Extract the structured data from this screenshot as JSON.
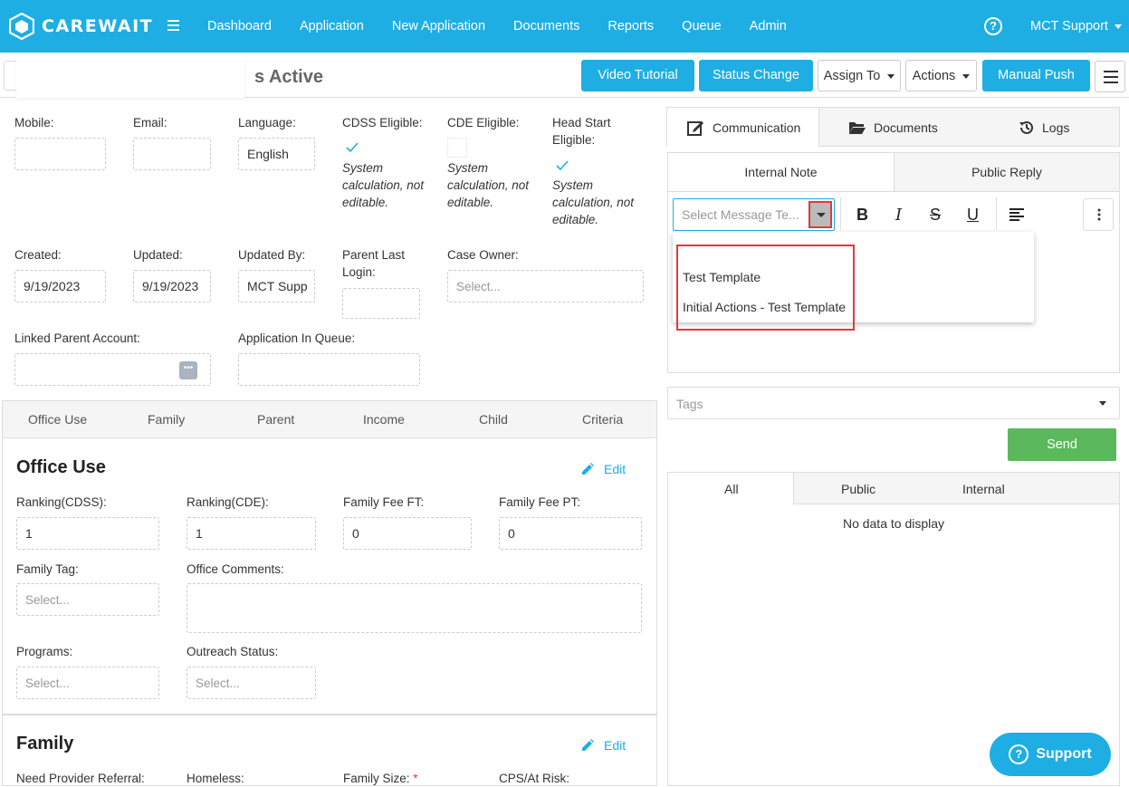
{
  "app": {
    "logo_text": "CAREWAIT"
  },
  "nav": {
    "items": [
      "Dashboard",
      "Application",
      "New Application",
      "Documents",
      "Reports",
      "Queue",
      "Admin"
    ],
    "user": "MCT Support"
  },
  "header": {
    "title_partial": "s Active"
  },
  "actions": {
    "video_tutorial": "Video Tutorial",
    "status_change": "Status Change",
    "assign_to": "Assign To",
    "actions": "Actions",
    "manual_push": "Manual Push"
  },
  "form": {
    "mobile_label": "Mobile:",
    "email_label": "Email:",
    "language_label": "Language:",
    "language_value": "English",
    "cdss_label": "CDSS Eligible:",
    "cde_label": "CDE Eligible:",
    "headstart_label": "Head Start Eligible:",
    "system_note": "System calculation, not editable.",
    "created_label": "Created:",
    "created_value": "9/19/2023",
    "updated_label": "Updated:",
    "updated_value": "9/19/2023",
    "updated_by_label": "Updated By:",
    "updated_by_value": "MCT Supp",
    "parent_login_label": "Parent Last Login:",
    "case_owner_label": "Case Owner:",
    "case_owner_placeholder": "Select...",
    "linked_parent_label": "Linked Parent Account:",
    "app_queue_label": "Application In Queue:"
  },
  "section_tabs": [
    "Office Use",
    "Family",
    "Parent",
    "Income",
    "Child",
    "Criteria"
  ],
  "office_use": {
    "title": "Office Use",
    "edit": "Edit",
    "ranking_cdss_label": "Ranking(CDSS):",
    "ranking_cdss": "1",
    "ranking_cde_label": "Ranking(CDE):",
    "ranking_cde": "1",
    "fee_ft_label": "Family Fee FT:",
    "fee_ft": "0",
    "fee_pt_label": "Family Fee PT:",
    "fee_pt": "0",
    "family_tag_label": "Family Tag:",
    "family_tag_placeholder": "Select...",
    "office_comments_label": "Office Comments:",
    "programs_label": "Programs:",
    "programs_placeholder": "Select...",
    "outreach_label": "Outreach Status:",
    "outreach_placeholder": "Select..."
  },
  "family": {
    "title": "Family",
    "edit": "Edit",
    "need_referral_label": "Need Provider Referral:",
    "homeless_label": "Homeless:",
    "family_size_label": "Family Size:",
    "required_mark": "*",
    "cps_label": "CPS/At Risk:"
  },
  "right_panel": {
    "tabs": [
      "Communication",
      "Documents",
      "Logs"
    ],
    "subtabs": [
      "Internal Note",
      "Public Reply"
    ],
    "template_placeholder": "Select Message Te...",
    "dropdown_items": [
      "Test Template",
      "Initial Actions - Test Template"
    ],
    "tags_placeholder": "Tags",
    "send": "Send",
    "filters": [
      "All",
      "Public",
      "Internal"
    ],
    "empty_text": "No data to display"
  },
  "support": {
    "label": "Support"
  },
  "colors": {
    "brand": "#1eaee4",
    "send": "#5cb85c",
    "highlight": "#e0393e"
  }
}
